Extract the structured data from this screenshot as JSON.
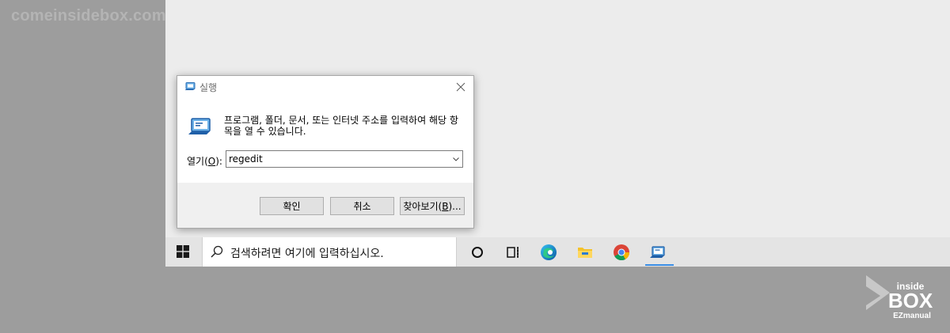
{
  "watermark": "comeinsidebox.com",
  "dialog": {
    "title": "실행",
    "description": "프로그램, 폴더, 문서, 또는 인터넷 주소를 입력하여 해당 항목을 열 수 있습니다.",
    "open_label_prefix": "열기(",
    "open_label_mnemonic": "O",
    "open_label_suffix": "):",
    "open_value": "regedit",
    "ok_label": "확인",
    "cancel_label": "취소",
    "browse_label_prefix": "찾아보기(",
    "browse_label_mnemonic": "B",
    "browse_label_suffix": ")..."
  },
  "taskbar": {
    "search_placeholder": "검색하려면 여기에 입력하십시오.",
    "icons": [
      "windows-start-icon",
      "search-icon",
      "cortana-icon",
      "task-view-icon",
      "edge-icon",
      "file-explorer-icon",
      "chrome-icon",
      "run-icon"
    ],
    "accent": "#3a8ee6"
  },
  "logo": {
    "line1": "inside",
    "line2": "BOX",
    "line3": "EZmanual"
  }
}
